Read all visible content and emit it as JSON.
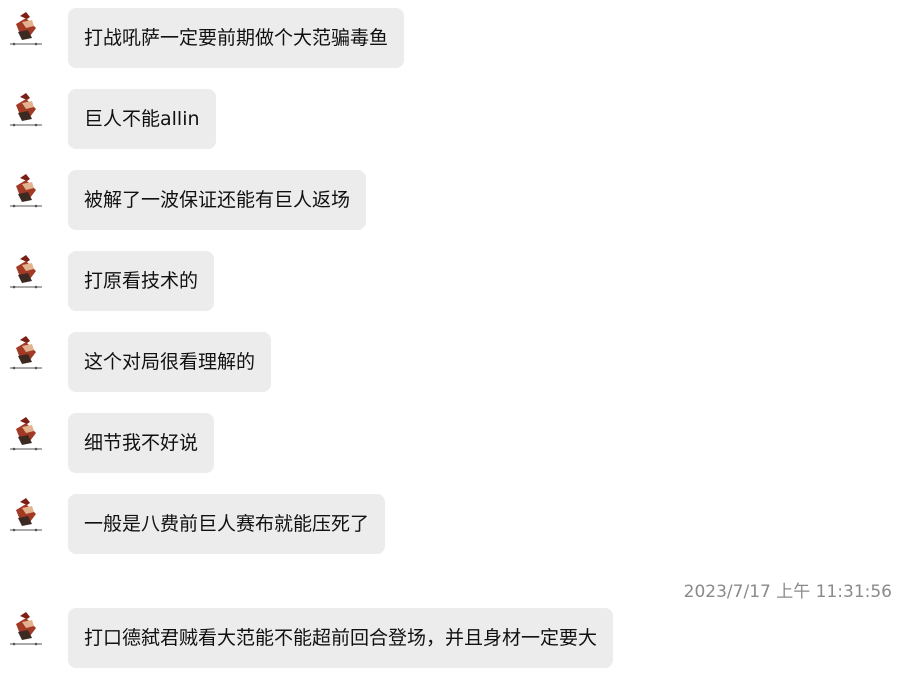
{
  "messages": [
    {
      "text": "打战吼萨一定要前期做个大范骗毒鱼"
    },
    {
      "text": "巨人不能allin"
    },
    {
      "text": "被解了一波保证还能有巨人返场"
    },
    {
      "text": "打原看技术的"
    },
    {
      "text": "这个对局很看理解的"
    },
    {
      "text": "细节我不好说"
    },
    {
      "text": "一般是八费前巨人赛布就能压死了"
    },
    {
      "text": "打口德弑君贼看大范能不能超前回合登场，并且身材一定要大"
    }
  ],
  "timestamp": "2023/7/17 上午 11:31:56",
  "avatar_icon": "sender-avatar-icon",
  "colors": {
    "bubble": "#ececec",
    "text": "#111111",
    "timestamp": "#8a8a8a",
    "background": "#ffffff"
  }
}
